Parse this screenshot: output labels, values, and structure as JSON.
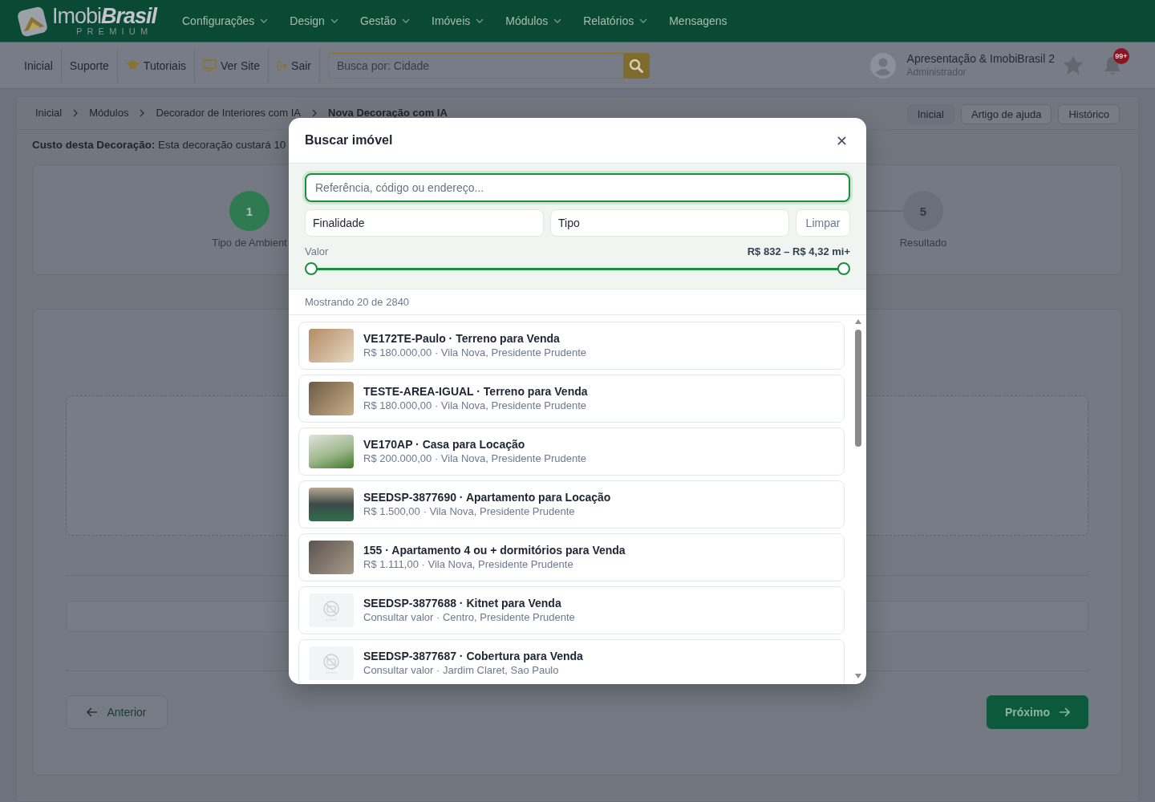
{
  "top_nav": {
    "logo": {
      "name": "Imobi**Brasil**",
      "tagline": "PREMIUM"
    },
    "items": [
      {
        "label": "Configurações",
        "dropdown": true
      },
      {
        "label": "Design",
        "dropdown": true
      },
      {
        "label": "Gestão",
        "dropdown": true
      },
      {
        "label": "Imóveis",
        "dropdown": true
      },
      {
        "label": "Módulos",
        "dropdown": true
      },
      {
        "label": "Relatórios",
        "dropdown": true
      },
      {
        "label": "Mensagens",
        "dropdown": false
      }
    ]
  },
  "toolbar": {
    "links": [
      {
        "label": "Inicial",
        "kind": "plain"
      },
      {
        "label": "Suporte",
        "kind": "plain"
      },
      {
        "label": "Tutoriais",
        "kind": "tutorials"
      },
      {
        "label": "Ver Site",
        "kind": "site"
      },
      {
        "label": "Sair",
        "kind": "logout"
      }
    ],
    "search": {
      "placeholder": "Busca por: Cidade"
    },
    "user": {
      "name": "Apresentação & ImobiBrasil 2",
      "role": "Administrador"
    },
    "notifications": {
      "badge": "99+"
    }
  },
  "breadcrumb": [
    {
      "label": "Inicial",
      "current": false
    },
    {
      "label": "Módulos",
      "current": false
    },
    {
      "label": "Decorador de Interiores com IA",
      "current": false
    },
    {
      "label": "Nova Decoração com IA",
      "current": true
    }
  ],
  "header_buttons": [
    "Inicial",
    "Artigo de ajuda",
    "Histórico"
  ],
  "cost": "**Custo desta Decoração:** Esta decoração custará 10",
  "steps": [
    {
      "number": "1",
      "label": "Tipo de Ambient",
      "active": true
    },
    {
      "number": "5",
      "label": "Resultado",
      "active": false
    }
  ],
  "wizard_buttons": {
    "previous": "Anterior",
    "next": "Próximo"
  },
  "modal": {
    "title": "Buscar imóvel",
    "search": {
      "placeholder": "Referência, código ou endereço...",
      "focused": true
    },
    "selects": [
      "Finalidade",
      "Tipo"
    ],
    "clear_button": "Limpar",
    "range": {
      "label": "Valor",
      "reading": "R$ 832 – R$ 4,32 mi+",
      "handles": [
        {
          "level": 0
        },
        {
          "level": 1
        }
      ]
    },
    "count": "Mostrando 20 de 2840",
    "results": [
      {
        "title": "VE172TE-Paulo · Terreno para Venda",
        "details": "R$ 180.000,00 · Vila Nova, Presidente Prudente",
        "kind": "photo"
      },
      {
        "title": "TESTE-AREA-IGUAL · Terreno para Venda",
        "details": "R$ 180.000,00 · Vila Nova, Presidente Prudente",
        "kind": "photo"
      },
      {
        "title": "VE170AP · Casa para Locação",
        "details": "R$ 200.000,00 · Vila Nova, Presidente Prudente",
        "kind": "photo"
      },
      {
        "title": "SEEDSP-3877690 · Apartamento para Locação",
        "details": "R$ 1.500,00 · Vila Nova, Presidente Prudente",
        "kind": "photo"
      },
      {
        "title": "155 · Apartamento 4 ou + dormitórios para Venda",
        "details": "R$ 1.111,00 · Vila Nova, Presidente Prudente",
        "kind": "photo"
      },
      {
        "title": "SEEDSP-3877688 · Kitnet para Venda",
        "details": "Consultar valor · Centro, Presidente Prudente",
        "kind": "nophoto"
      },
      {
        "title": "SEEDSP-3877687 · Cobertura para Venda",
        "details": "Consultar valor · Jardim Claret, Sao Paulo",
        "kind": "nophoto"
      }
    ]
  }
}
